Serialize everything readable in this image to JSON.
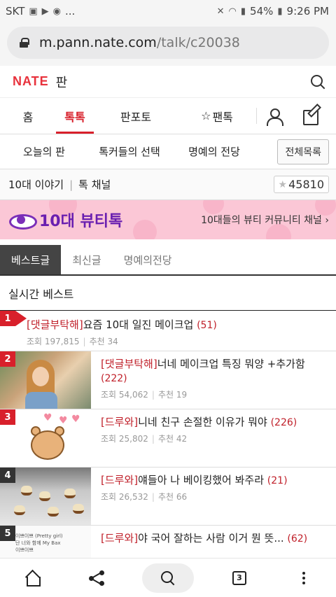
{
  "status": {
    "carrier": "SKT",
    "more": "...",
    "battery": "54%",
    "time": "9:26 PM"
  },
  "browser": {
    "url_host": "m.pann.nate.com",
    "url_path": "/talk/c20038",
    "tab_count": "3"
  },
  "header": {
    "logo": "NATE",
    "section": "판"
  },
  "mainnav": {
    "home": "홈",
    "talk": "톡톡",
    "pannpoto": "판포토",
    "fantalk": "팬톡"
  },
  "subnav": {
    "today": "오늘의 판",
    "talker_choice": "톡커들의 선택",
    "hall_of_fame": "명예의 전당",
    "all_list": "전체목록"
  },
  "channel": {
    "name": "10대 이야기",
    "type": "톡 채널",
    "star_count": "45810"
  },
  "banner": {
    "title": "10대 뷰티톡",
    "description": "10대들의 뷰티 커뮤니티 채널 ›"
  },
  "tabs": {
    "best": "베스트글",
    "latest": "최신글",
    "hall": "명예의전당"
  },
  "section_title": "실시간 베스트",
  "posts": [
    {
      "rank": "1",
      "tag": "[댓글부탁해]",
      "title": "요즘 10대 일진 메이크업",
      "comments": "(51)",
      "views": "조회 197,815",
      "likes": "추천 34"
    },
    {
      "rank": "2",
      "tag": "[댓글부탁해]",
      "title": "너네 메이크업 특징 뭐양 +추가함",
      "comments": "(222)",
      "views": "조회 54,062",
      "likes": "추천 19"
    },
    {
      "rank": "3",
      "tag": "[드루와]",
      "title": "니네 친구 손절한 이유가 뭐야",
      "comments": "(226)",
      "views": "조회 25,802",
      "likes": "추천 42"
    },
    {
      "rank": "4",
      "tag": "[드루와]",
      "title": "얘들아 나 베이킹했어 봐주라",
      "comments": "(21)",
      "views": "조회 26,532",
      "likes": "추천 66"
    },
    {
      "rank": "5",
      "tag": "[드루와]",
      "title": "야 국어 잘하는 사람 이거 뭔 뜻...",
      "comments": "(62)",
      "views": "",
      "likes": ""
    }
  ],
  "thumb_doc": {
    "line1": "이쁘이쁘 (Pretty girl)",
    "line2": "단 너와 함께 My Bax",
    "line3": "이쁘이쁘"
  },
  "colors": {
    "accent": "#d8202b",
    "banner_bg": "#fbc7d6",
    "banner_title": "#6a1fb0"
  }
}
